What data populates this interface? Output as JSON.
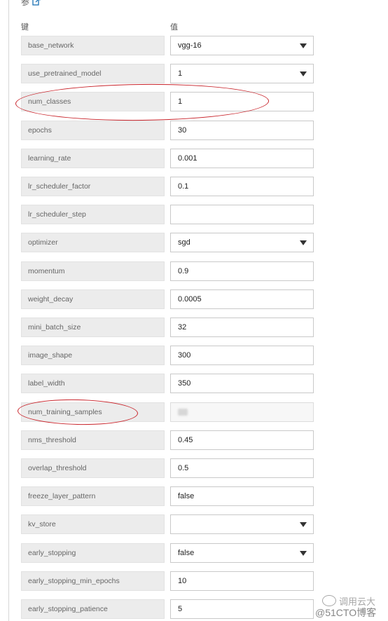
{
  "section": {
    "title": "参"
  },
  "headers": {
    "key": "键",
    "value": "值"
  },
  "rows": [
    {
      "key": "base_network",
      "value": "vgg-16",
      "type": "select"
    },
    {
      "key": "use_pretrained_model",
      "value": "1",
      "type": "select"
    },
    {
      "key": "num_classes",
      "value": "1",
      "type": "input"
    },
    {
      "key": "epochs",
      "value": "30",
      "type": "input"
    },
    {
      "key": "learning_rate",
      "value": "0.001",
      "type": "input"
    },
    {
      "key": "lr_scheduler_factor",
      "value": "0.1",
      "type": "input"
    },
    {
      "key": "lr_scheduler_step",
      "value": "",
      "type": "input"
    },
    {
      "key": "optimizer",
      "value": "sgd",
      "type": "select"
    },
    {
      "key": "momentum",
      "value": "0.9",
      "type": "input"
    },
    {
      "key": "weight_decay",
      "value": "0.0005",
      "type": "input"
    },
    {
      "key": "mini_batch_size",
      "value": "32",
      "type": "input"
    },
    {
      "key": "image_shape",
      "value": "300",
      "type": "input"
    },
    {
      "key": "label_width",
      "value": "350",
      "type": "input"
    },
    {
      "key": "num_training_samples",
      "value": "",
      "type": "redacted"
    },
    {
      "key": "nms_threshold",
      "value": "0.45",
      "type": "input"
    },
    {
      "key": "overlap_threshold",
      "value": "0.5",
      "type": "input"
    },
    {
      "key": "freeze_layer_pattern",
      "value": "false",
      "type": "input"
    },
    {
      "key": "kv_store",
      "value": "",
      "type": "select"
    },
    {
      "key": "early_stopping",
      "value": "false",
      "type": "select"
    },
    {
      "key": "early_stopping_min_epochs",
      "value": "10",
      "type": "input"
    },
    {
      "key": "early_stopping_patience",
      "value": "5",
      "type": "input"
    }
  ],
  "watermark": {
    "top": "调用云大",
    "bottom": "@51CTO博客"
  },
  "colors": {
    "highlight": "#c8232a",
    "key_bg": "#ececec",
    "link": "#2b7bb9"
  },
  "icons": {
    "section": "edit-external-icon",
    "select": "caret-down-icon",
    "watermark": "wechat-icon"
  }
}
